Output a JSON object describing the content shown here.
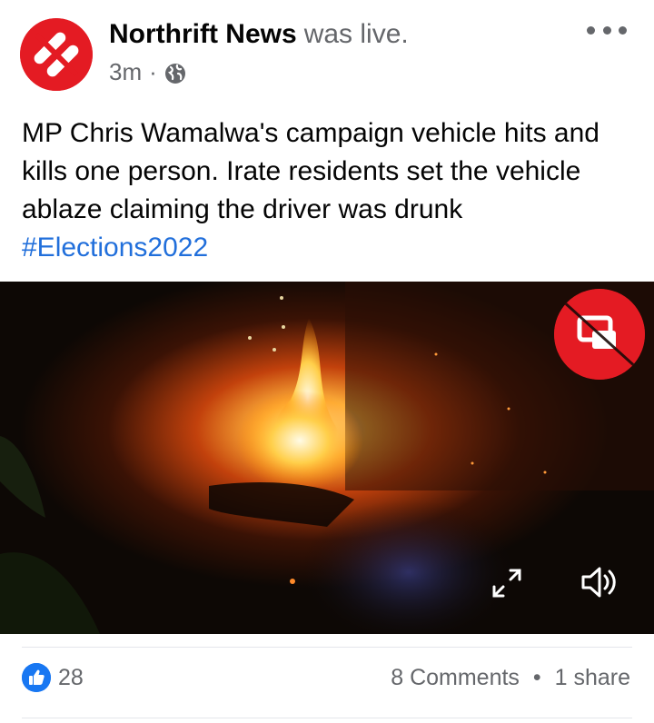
{
  "post": {
    "page_name": "Northrift News",
    "live_label": "was live.",
    "time": "3m",
    "separator": "·",
    "privacy_icon": "globe-icon",
    "more_icon": "more-options-icon",
    "text": "MP Chris Wamalwa's campaign vehicle hits and kills one person. Irate residents set the vehicle ablaze claiming the driver was drunk",
    "hashtag": "#Elections2022"
  },
  "video": {
    "overlay_icons": [
      "picture-in-picture-icon",
      "expand-icon",
      "volume-icon"
    ]
  },
  "reactions": {
    "like_icon": "thumbs-up-icon",
    "count": "28",
    "comments": "8 Comments",
    "dot": "•",
    "shares": "1 share"
  },
  "colors": {
    "brand_red": "#e41b23",
    "link_blue": "#216fdb",
    "like_blue": "#1877f2",
    "secondary_text": "#65676b"
  }
}
